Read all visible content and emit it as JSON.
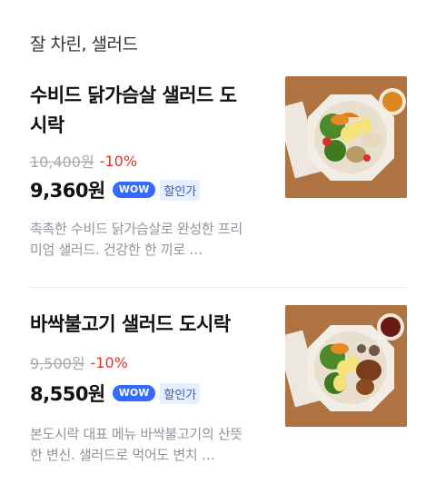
{
  "section": {
    "title": "잘 차린, 샐러드"
  },
  "products": [
    {
      "name": "수비드 닭가슴살 샐러드 도시락",
      "original_price": "10,400원",
      "discount": "-10%",
      "sale_price": "9,360원",
      "badge": "WOW",
      "member_label": "할인가",
      "description": "촉촉한 수비드 닭가슴살로 완성한 프리미엄 샐러드. 건강한 한 끼로 …",
      "image_icon": "salad-bowl-chicken-image"
    },
    {
      "name": "바싹불고기 샐러드 도시락",
      "original_price": "9,500원",
      "discount": "-10%",
      "sale_price": "8,550원",
      "badge": "WOW",
      "member_label": "할인가",
      "description": "본도시락 대표 메뉴 바싹불고기의 산뜻한 변신. 샐러드로 먹어도 변치 …",
      "image_icon": "salad-bowl-bulgogi-image"
    }
  ],
  "colors": {
    "discount": "#e0322c",
    "wow_badge": "#346aff",
    "strike_price": "#a8a8a8",
    "description": "#8f949d"
  }
}
